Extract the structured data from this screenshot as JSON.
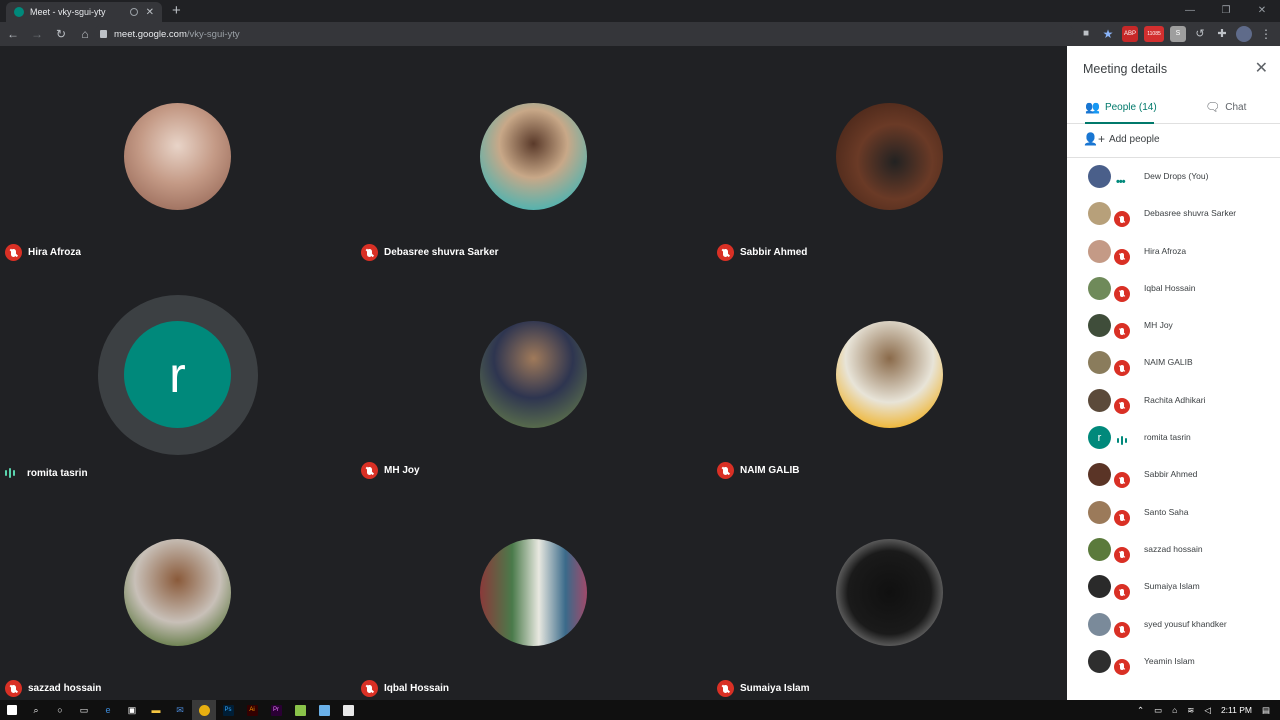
{
  "browser": {
    "tab_title": "Meet - vky-sgui-yty",
    "url_host": "meet.google.com",
    "url_path": "/vky-sgui-yty",
    "new_tab_glyph": "+",
    "close_glyph": "✕",
    "back_glyph": "←",
    "forward_glyph": "→",
    "reload_glyph": "↻",
    "home_glyph": "⌂",
    "min_glyph": "—",
    "max_glyph": "❐",
    "win_close_glyph": "✕",
    "menu_glyph": "⋮",
    "star_glyph": "★",
    "ext_abp": "ABP",
    "ext_badge": "11085",
    "ext_s": "S"
  },
  "tiles": [
    {
      "name": "Hira Afroza",
      "mic": "off",
      "avatar_color": "#c49a86"
    },
    {
      "name": "Debasree shuvra Sarker",
      "mic": "off",
      "avatar_color": "#b7a07a"
    },
    {
      "name": "Sabbir Ahmed",
      "mic": "off",
      "avatar_color": "#5a3426"
    },
    {
      "name": "romita tasrin",
      "mic": "speaking",
      "avatar_letter": "r",
      "avatar_color": "#00897b"
    },
    {
      "name": "MH Joy",
      "mic": "off",
      "avatar_color": "#3f4d3a"
    },
    {
      "name": "NAIM GALIB",
      "mic": "off",
      "avatar_color": "#8a7c5c"
    },
    {
      "name": "sazzad hossain",
      "mic": "off",
      "avatar_color": "#5b7a3c"
    },
    {
      "name": "Iqbal Hossain",
      "mic": "off",
      "avatar_color": "#6f8a5a"
    },
    {
      "name": "Sumaiya Islam",
      "mic": "off",
      "avatar_color": "#1e1e1e"
    }
  ],
  "panel": {
    "title": "Meeting details",
    "close_glyph": "✕",
    "tab_people": "People (14)",
    "tab_chat": "Chat",
    "add_people": "Add people",
    "people": [
      {
        "name": "Dew Drops (You)",
        "status": "self",
        "avatar_color": "#4a5f8a"
      },
      {
        "name": "Debasree shuvra Sarker",
        "status": "off",
        "avatar_color": "#b7a07a"
      },
      {
        "name": "Hira Afroza",
        "status": "off",
        "avatar_color": "#c49a86"
      },
      {
        "name": "Iqbal Hossain",
        "status": "off",
        "avatar_color": "#6f8a5a"
      },
      {
        "name": "MH Joy",
        "status": "off",
        "avatar_color": "#3f4d3a"
      },
      {
        "name": "NAIM GALIB",
        "status": "off",
        "avatar_color": "#8a7c5c"
      },
      {
        "name": "Rachita Adhikari",
        "status": "off",
        "avatar_color": "#5b4a3a"
      },
      {
        "name": "romita tasrin",
        "status": "speaking",
        "avatar_letter": "r",
        "avatar_color": "#00897b"
      },
      {
        "name": "Sabbir Ahmed",
        "status": "off",
        "avatar_color": "#5a3426"
      },
      {
        "name": "Santo Saha",
        "status": "off",
        "avatar_color": "#9b7a5a"
      },
      {
        "name": "sazzad hossain",
        "status": "off",
        "avatar_color": "#5b7a3c"
      },
      {
        "name": "Sumaiya Islam",
        "status": "off",
        "avatar_color": "#2a2a2a"
      },
      {
        "name": "syed yousuf khandker",
        "status": "off",
        "avatar_color": "#7a8a9a"
      },
      {
        "name": "Yeamin Islam",
        "status": "off",
        "avatar_color": "#2e2e2e"
      }
    ]
  },
  "taskbar": {
    "clock": "2:11 PM",
    "apps": [
      "start",
      "search",
      "cortana",
      "task-view",
      "edge",
      "store",
      "explorer",
      "mail",
      "chrome",
      "photoshop",
      "illustrator",
      "premiere",
      "notepad",
      "paint",
      "photos"
    ]
  }
}
